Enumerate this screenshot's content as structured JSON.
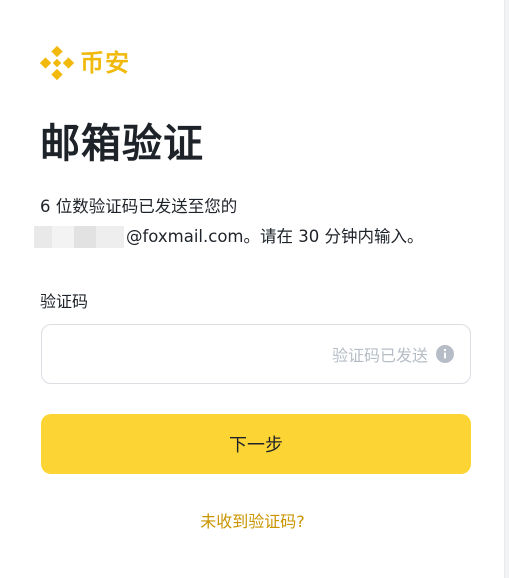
{
  "brand": {
    "name": "币安",
    "logo_icon": "binance-logo-icon",
    "color": "#f0b90b"
  },
  "page": {
    "title": "邮箱验证",
    "description_line1": "6 位数验证码已发送至您的",
    "email_suffix": "@foxmail.com。请在 30 分钟内输入。"
  },
  "form": {
    "code_label": "验证码",
    "code_value": "",
    "code_placeholder": "",
    "sent_hint": "验证码已发送",
    "info_icon": "info-icon"
  },
  "actions": {
    "next_label": "下一步",
    "next_color": "#fcd535",
    "resend_label": "未收到验证码?",
    "resend_color": "#c99400"
  }
}
